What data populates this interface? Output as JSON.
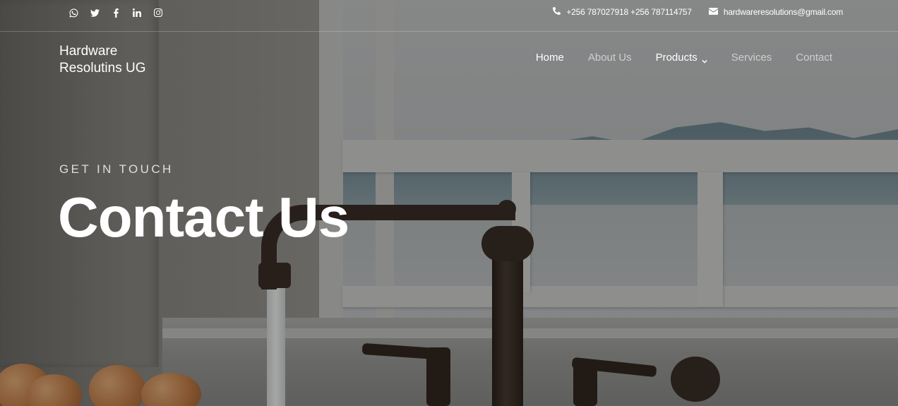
{
  "topbar": {
    "social_icons": [
      "whatsapp-icon",
      "twitter-icon",
      "facebook-icon",
      "linkedin-icon",
      "instagram-icon"
    ],
    "phone": "+256 787027918 +256 787114757",
    "email": "hardwareresolutions@gmail.com"
  },
  "brand": {
    "line1": "Hardware",
    "line2": "Resolutins UG"
  },
  "nav": {
    "home": "Home",
    "about": "About Us",
    "products": "Products",
    "services": "Services",
    "contact": "Contact"
  },
  "hero": {
    "eyebrow": "GET IN TOUCH",
    "title": "Contact Us"
  },
  "colors": {
    "text": "#ffffff",
    "muted_text": "rgba(255,255,255,0.6)",
    "overlay": "rgba(0,0,0,0.32)"
  }
}
